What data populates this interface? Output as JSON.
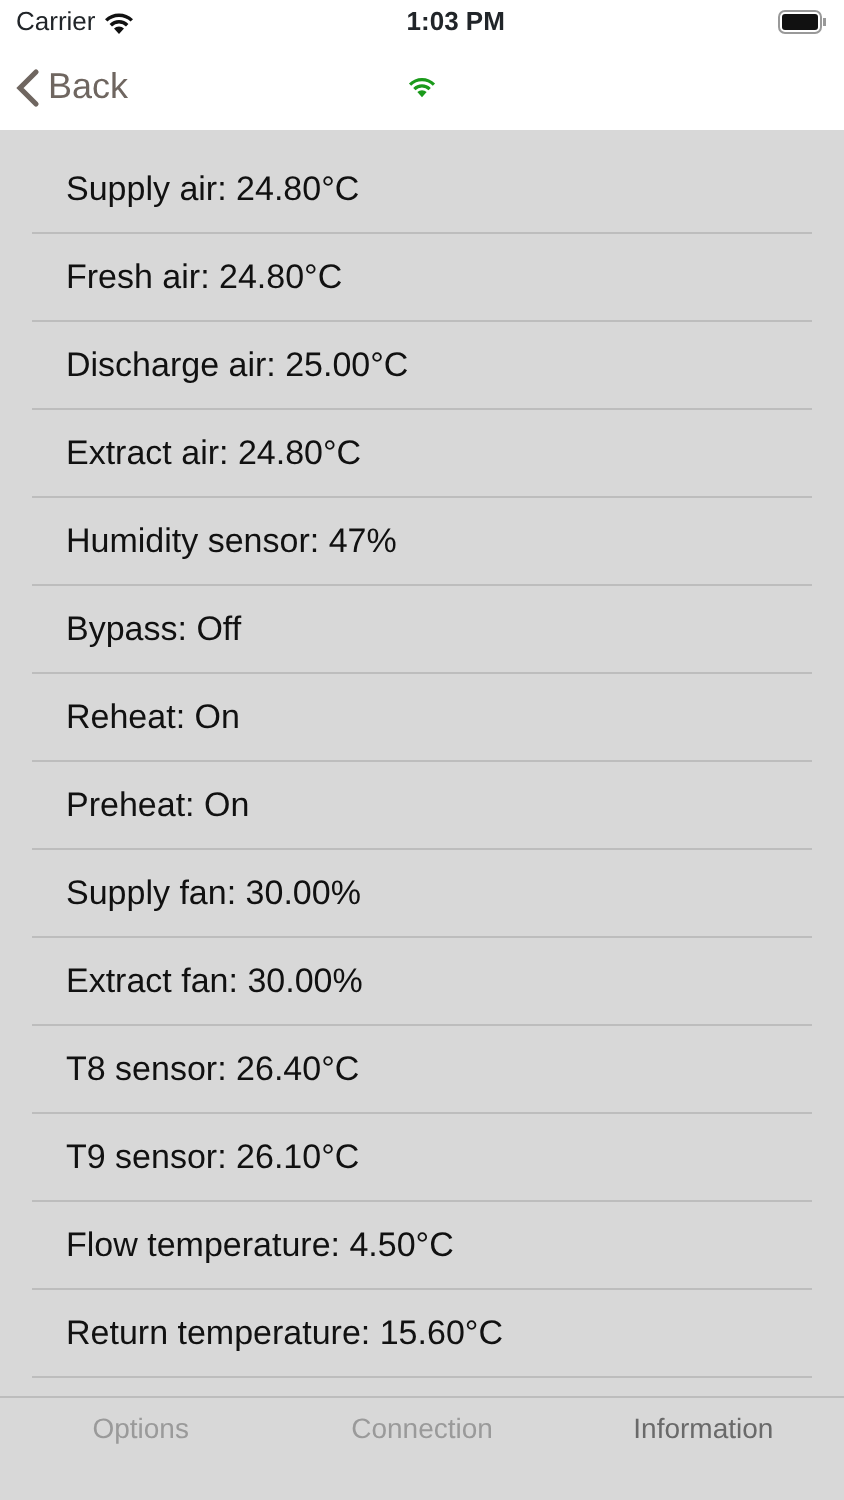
{
  "status_bar": {
    "carrier": "Carrier",
    "time": "1:03 PM"
  },
  "nav": {
    "back": "Back",
    "connected": true
  },
  "items": [
    {
      "text": "Supply air: 24.80°C"
    },
    {
      "text": "Fresh air: 24.80°C"
    },
    {
      "text": "Discharge air: 25.00°C"
    },
    {
      "text": "Extract air: 24.80°C"
    },
    {
      "text": "Humidity sensor: 47%"
    },
    {
      "text": "Bypass: Off"
    },
    {
      "text": "Reheat: On"
    },
    {
      "text": "Preheat: On"
    },
    {
      "text": "Supply fan: 30.00%"
    },
    {
      "text": "Extract fan: 30.00%"
    },
    {
      "text": "T8 sensor: 26.40°C"
    },
    {
      "text": "T9 sensor: 26.10°C"
    },
    {
      "text": "Flow temperature: 4.50°C"
    },
    {
      "text": "Return temperature: 15.60°C"
    }
  ],
  "tabs": [
    {
      "label": "Options",
      "selected": false
    },
    {
      "label": "Connection",
      "selected": false
    },
    {
      "label": "Information",
      "selected": true
    }
  ]
}
